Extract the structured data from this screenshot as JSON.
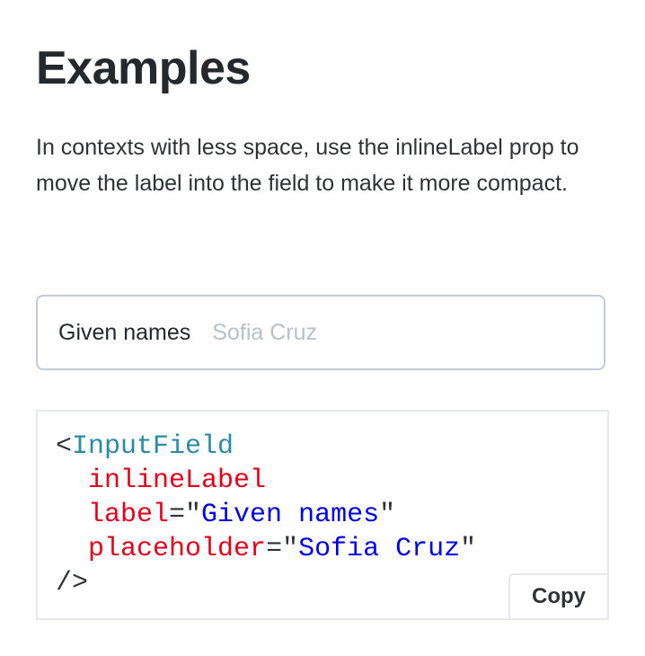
{
  "section": {
    "title": "Examples",
    "description": "In contexts with less space, use the inlineLabel prop to move the label into the field to make it more compact."
  },
  "example_field": {
    "label": "Given names",
    "value": "",
    "placeholder": "Sofia Cruz"
  },
  "code_sample": {
    "open_bracket": "<",
    "tag": "InputField",
    "attr_inline": "inlineLabel",
    "attr_label": "label",
    "eq": "=\"",
    "label_value": "Given names",
    "quote_close": "\"",
    "attr_placeholder": "placeholder",
    "placeholder_value": "Sofia Cruz",
    "close": "/>",
    "copy_label": "Copy"
  },
  "colors": {
    "tag": "#2b8aa6",
    "attribute": "#e3001b",
    "string": "#0000e6",
    "field_border": "#c3ccd6",
    "placeholder": "#b4c0cc"
  }
}
